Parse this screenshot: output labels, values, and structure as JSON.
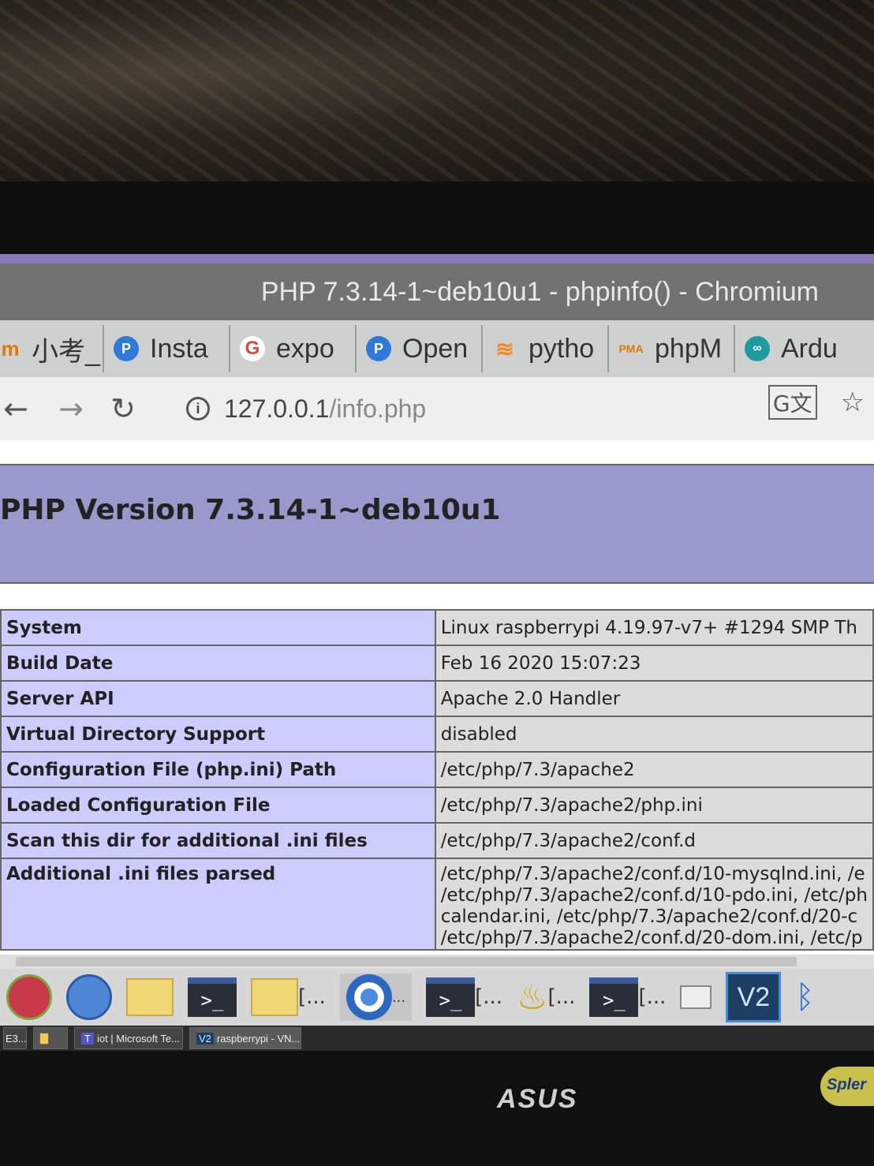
{
  "window": {
    "title": "PHP 7.3.14-1~deb10u1 - phpinfo() - Chromium"
  },
  "tabs": [
    {
      "icon": "m-icon",
      "label": "小考_"
    },
    {
      "icon": "p-icon",
      "label": "Insta"
    },
    {
      "icon": "google-icon",
      "label": "expo"
    },
    {
      "icon": "p-icon",
      "label": "Open"
    },
    {
      "icon": "stackoverflow-icon",
      "label": "pytho"
    },
    {
      "icon": "pma-icon",
      "label": "phpM"
    },
    {
      "icon": "arduino-icon",
      "label": "Ardu"
    }
  ],
  "address": {
    "host": "127.0.0.1",
    "path": "/info.php"
  },
  "php": {
    "header": "PHP Version 7.3.14-1~deb10u1",
    "rows": [
      {
        "label": "System",
        "value": "Linux raspberrypi 4.19.97-v7+ #1294 SMP Th"
      },
      {
        "label": "Build Date",
        "value": "Feb 16 2020 15:07:23"
      },
      {
        "label": "Server API",
        "value": "Apache 2.0 Handler"
      },
      {
        "label": "Virtual Directory Support",
        "value": "disabled"
      },
      {
        "label": "Configuration File (php.ini) Path",
        "value": "/etc/php/7.3/apache2"
      },
      {
        "label": "Loaded Configuration File",
        "value": "/etc/php/7.3/apache2/php.ini"
      },
      {
        "label": "Scan this dir for additional .ini files",
        "value": "/etc/php/7.3/apache2/conf.d"
      },
      {
        "label": "Additional .ini files parsed",
        "lines": [
          "/etc/php/7.3/apache2/conf.d/10-mysqlnd.ini, /e",
          "/etc/php/7.3/apache2/conf.d/10-pdo.ini, /etc/ph",
          "calendar.ini, /etc/php/7.3/apache2/conf.d/20-c",
          "/etc/php/7.3/apache2/conf.d/20-dom.ini, /etc/p"
        ]
      }
    ]
  },
  "panel": {
    "folder1": "[...",
    "chrome": "...",
    "term2": "[...",
    "lamp": "[...",
    "term3": "[..."
  },
  "windows": [
    {
      "label": "E3..."
    },
    {
      "label": "iot | Microsoft Te..."
    },
    {
      "label": "raspberrypi - VN..."
    }
  ],
  "monitor": {
    "brand": "ASUS",
    "sticker": "Spler"
  }
}
